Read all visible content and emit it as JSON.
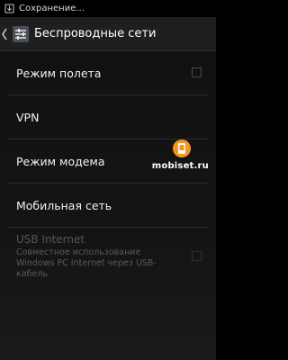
{
  "status_bar": {
    "notification_text": "Сохранение..."
  },
  "action_bar": {
    "title": "Беспроводные сети"
  },
  "settings": {
    "items": [
      {
        "label": "Режим полета",
        "has_checkbox": true,
        "checked": false,
        "enabled": true
      },
      {
        "label": "VPN",
        "enabled": true
      },
      {
        "label": "Режим модема",
        "enabled": true
      },
      {
        "label": "Мобильная сеть",
        "enabled": true
      },
      {
        "label": "USB Internet",
        "summary": "Совместное использование Windows PC Internet через USB-кабель",
        "has_checkbox": true,
        "checked": false,
        "enabled": false
      }
    ]
  },
  "watermark": {
    "text": "mobiset.ru",
    "accent_color": "#f7941d"
  },
  "colors": {
    "background": "#111111",
    "action_bar": "#1f1f1f",
    "divider": "#2b2b2b",
    "disabled_text": "#555555"
  }
}
